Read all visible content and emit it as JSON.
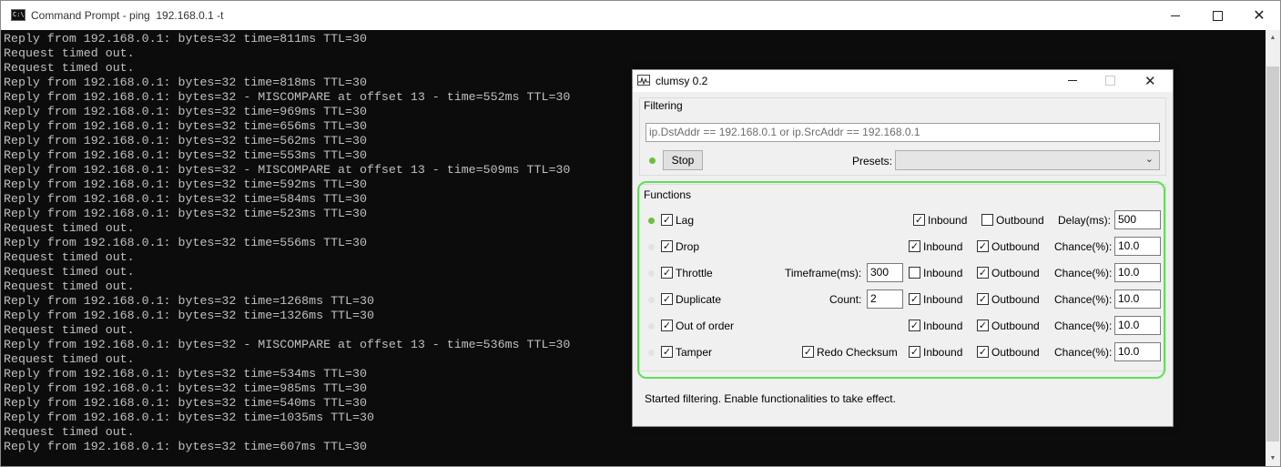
{
  "cmd": {
    "title": "Command Prompt - ping  192.168.0.1 -t",
    "icon_text": "C:\\",
    "lines": [
      "Reply from 192.168.0.1: bytes=32 time=811ms TTL=30",
      "Request timed out.",
      "Request timed out.",
      "Reply from 192.168.0.1: bytes=32 time=818ms TTL=30",
      "Reply from 192.168.0.1: bytes=32 - MISCOMPARE at offset 13 - time=552ms TTL=30",
      "Reply from 192.168.0.1: bytes=32 time=969ms TTL=30",
      "Reply from 192.168.0.1: bytes=32 time=656ms TTL=30",
      "Reply from 192.168.0.1: bytes=32 time=562ms TTL=30",
      "Reply from 192.168.0.1: bytes=32 time=553ms TTL=30",
      "Reply from 192.168.0.1: bytes=32 - MISCOMPARE at offset 13 - time=509ms TTL=30",
      "Reply from 192.168.0.1: bytes=32 time=592ms TTL=30",
      "Reply from 192.168.0.1: bytes=32 time=584ms TTL=30",
      "Reply from 192.168.0.1: bytes=32 time=523ms TTL=30",
      "Request timed out.",
      "Reply from 192.168.0.1: bytes=32 time=556ms TTL=30",
      "Request timed out.",
      "Request timed out.",
      "Request timed out.",
      "Reply from 192.168.0.1: bytes=32 time=1268ms TTL=30",
      "Reply from 192.168.0.1: bytes=32 time=1326ms TTL=30",
      "Request timed out.",
      "Reply from 192.168.0.1: bytes=32 - MISCOMPARE at offset 13 - time=536ms TTL=30",
      "Request timed out.",
      "Reply from 192.168.0.1: bytes=32 time=534ms TTL=30",
      "Reply from 192.168.0.1: bytes=32 time=985ms TTL=30",
      "Reply from 192.168.0.1: bytes=32 time=540ms TTL=30",
      "Reply from 192.168.0.1: bytes=32 time=1035ms TTL=30",
      "Request timed out.",
      "Reply from 192.168.0.1: bytes=32 time=607ms TTL=30"
    ]
  },
  "clumsy": {
    "title": "clumsy 0.2",
    "filtering": {
      "label": "Filtering",
      "filter_value": "ip.DstAddr == 192.168.0.1 or ip.SrcAddr == 192.168.0.1",
      "stop_label": "Stop",
      "presets_label": "Presets:",
      "presets_value": ""
    },
    "functions": {
      "label": "Functions",
      "check_mark": "✓",
      "rows": [
        {
          "name": "Lag",
          "active": true,
          "enabled": true,
          "inbound_label": "Inbound",
          "inbound": true,
          "outbound_label": "Outbound",
          "outbound": false,
          "param_label": "Delay(ms):",
          "param_value": "500"
        },
        {
          "name": "Drop",
          "active": false,
          "enabled": true,
          "inbound_label": "Inbound",
          "inbound": true,
          "outbound_label": "Outbound",
          "outbound": true,
          "param_label": "Chance(%):",
          "param_value": "10.0"
        },
        {
          "name": "Throttle",
          "active": false,
          "enabled": true,
          "extra_label": "Timeframe(ms):",
          "extra_value": "300",
          "inbound_label": "Inbound",
          "inbound": false,
          "outbound_label": "Outbound",
          "outbound": true,
          "param_label": "Chance(%):",
          "param_value": "10.0"
        },
        {
          "name": "Duplicate",
          "active": false,
          "enabled": true,
          "extra_label": "Count:",
          "extra_value": "2",
          "inbound_label": "Inbound",
          "inbound": true,
          "outbound_label": "Outbound",
          "outbound": true,
          "param_label": "Chance(%):",
          "param_value": "10.0"
        },
        {
          "name": "Out of order",
          "active": false,
          "enabled": true,
          "inbound_label": "Inbound",
          "inbound": true,
          "outbound_label": "Outbound",
          "outbound": true,
          "param_label": "Chance(%):",
          "param_value": "10.0"
        },
        {
          "name": "Tamper",
          "active": false,
          "enabled": true,
          "extra_check_label": "Redo Checksum",
          "extra_check": true,
          "inbound_label": "Inbound",
          "inbound": true,
          "outbound_label": "Outbound",
          "outbound": true,
          "param_label": "Chance(%):",
          "param_value": "10.0"
        }
      ]
    },
    "status": "Started filtering. Enable functionalities to take effect."
  },
  "colors": {
    "console_bg": "#0c0c0c",
    "console_text": "#c0c0c0",
    "active_dot": "#6cbf3a",
    "highlight": "#5fe05a"
  }
}
